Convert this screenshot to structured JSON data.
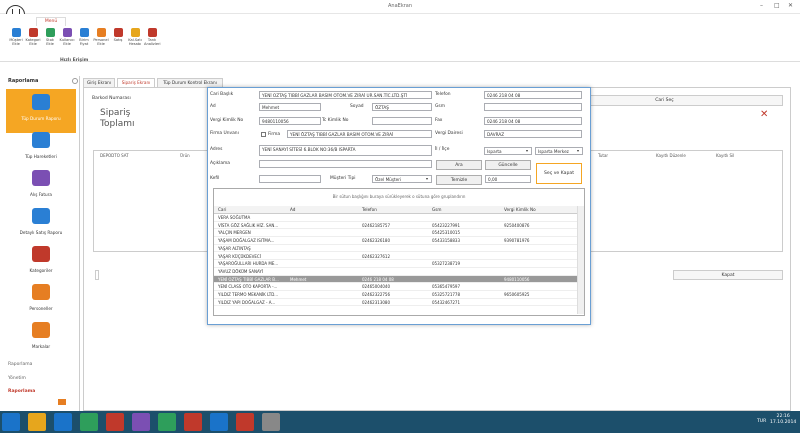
{
  "window": {
    "title": "AnaEkran"
  },
  "ribbon": {
    "tab": "Menü",
    "group": "Hızlı Erişim",
    "buttons": [
      {
        "label": "Müşteri Ekle",
        "color": "#2a7fd4"
      },
      {
        "label": "Kategori Ekle",
        "color": "#c0392b"
      },
      {
        "label": "Stok Ekle",
        "color": "#2e9e5b"
      },
      {
        "label": "Kullanıcı Ekle",
        "color": "#7b4fb3"
      },
      {
        "label": "Birim Fiyat",
        "color": "#2a7fd4"
      },
      {
        "label": "Personel Ekle",
        "color": "#e67e22"
      },
      {
        "label": "Satış",
        "color": "#c0392b"
      },
      {
        "label": "Kal.Satı Hesabı",
        "color": "#e6a61d"
      },
      {
        "label": "Tank Analizleri",
        "color": "#c0392b"
      }
    ]
  },
  "sidebar": {
    "title": "Raporlama",
    "items": [
      {
        "label": "Tüp Durum Raporu",
        "icon": "report-icon",
        "color": "#2a7fd4"
      },
      {
        "label": "Tüp Hareketleri",
        "icon": "tube-icon",
        "color": "#2a7fd4"
      },
      {
        "label": "Alış Fatura",
        "icon": "invoice-icon",
        "color": "#7b4fb3"
      },
      {
        "label": "Detaylı Satış Raporu",
        "icon": "globe-icon",
        "color": "#2a7fd4"
      },
      {
        "label": "Kategoriler",
        "icon": "category-icon",
        "color": "#c0392b"
      },
      {
        "label": "Personeller",
        "icon": "people-icon",
        "color": "#e67e22"
      },
      {
        "label": "Markalar",
        "icon": "brand-icon",
        "color": "#e67e22"
      }
    ],
    "bottom": [
      "Raporlama",
      "Yönetim",
      "Raporlama"
    ]
  },
  "tabs": [
    "Giriş Ekranı",
    "Sipariş Ekranı",
    "Tüp Durum Kontrol Ekranı"
  ],
  "background": {
    "barkod": "Barkod Numarası",
    "title1": "Sipariş",
    "title2": "Toplamı",
    "cari_sec": "Cari Seç",
    "kapat": "Kapat",
    "columns": [
      "DEPODTO SAT",
      "Ürün",
      "Tutar",
      "Kayıtlı Düzenle",
      "Kayıtlı Sil"
    ]
  },
  "dialog": {
    "labels": {
      "cari": "Cari Başlık",
      "ad": "Ad",
      "soyad": "Soyad",
      "vergi_no": "Vergi Kimlik No",
      "tc": "Tc Kimlik No",
      "firma": "Firma Unvanı",
      "firma_chk": "Firma",
      "adres": "Adres",
      "aciklama": "Açıklama",
      "kefil": "Kefil",
      "musteri_tipi": "Müşteri Tipi",
      "telefon": "Telefon",
      "gsm": "Gsm",
      "fax": "Fax",
      "vergi_dairesi": "Vergi Dairesi",
      "il_ilce": "İl / İlçe"
    },
    "values": {
      "cari": "YENİ OZTAŞ TIBBİ GAZLAR BASIM OTOM.VE ZIRAİ UR.SAN.TİC.LTD.ŞTİ",
      "ad": "Mehmet",
      "soyad": "ÖZTAŞ",
      "vergi_no": "9480110056",
      "tc": "",
      "firma": "YENİ ÖZTAŞ TIBBİ GAZLAR BASIM OTOM.VE ZIRAİ",
      "adres": "YENİ SANAYİ SİTESİ 6.BLOK NO:36/B ISPARTA",
      "aciklama": "",
      "kefil": "",
      "musteri_tipi": "Özel Müşteri",
      "telefon": "0246 218 04 08",
      "gsm": "",
      "fax": "0246 218 04 08",
      "vergi_dairesi": "DAVRAZ",
      "il": "Isparta",
      "ilce": "Isparta Merkez",
      "tutar": "0,00"
    },
    "buttons": {
      "ara": "Ara",
      "guncelle": "Güncelle",
      "temizle": "Temizle",
      "sec_kapat": "Seç ve Kapat"
    },
    "grid": {
      "hint": "Bir sütun başlığını buraya sürükleyerek o sütuna göre gruplandırın",
      "columns": [
        "Cari",
        "Ad",
        "Telefon",
        "Gsm",
        "Vergi Kimlik No"
      ],
      "rows": [
        [
          "VERA SOĞUTMA",
          "",
          "",
          "",
          ""
        ],
        [
          "VİSTA GÖZ SAĞLIK HİZ. SAN...",
          "",
          "02462185757",
          "05423227991",
          "9250400876"
        ],
        [
          "YALÇIN MERGEN",
          "",
          "",
          "05425310015",
          ""
        ],
        [
          "YAŞAM DOĞALGAZ ISITMA...",
          "",
          "02462326180",
          "05433158833",
          "9390781976"
        ],
        [
          "YAŞAR ALTINTAŞ",
          "",
          "",
          "",
          ""
        ],
        [
          "YAŞAR KÜÇÜKDEVECİ",
          "",
          "02462327612",
          "",
          ""
        ],
        [
          "YAŞAROĞULLARI HURDA ME...",
          "",
          "",
          "05327238719",
          ""
        ],
        [
          "YAVUZ DÖKÜM SANAYİ",
          "",
          "",
          "",
          ""
        ],
        [
          "YENİ OZTAŞ TIBBİ GAZLAR B...",
          "Mehmet",
          "0246 218 04 08",
          "",
          "9480110056"
        ],
        [
          "YENİ CLASS OTO KAPORTA -...",
          "",
          "02465004040",
          "05365479597",
          ""
        ],
        [
          "YILDIZ TERMO MEKANİK LTD...",
          "",
          "02462322756",
          "05325721778",
          "9650605925"
        ],
        [
          "YILDIZ YAPI DOĞALGAZ - A...",
          "",
          "02462313080",
          "05432467271",
          ""
        ]
      ],
      "selected": 8
    }
  },
  "taskbar": {
    "time": "22:16",
    "date": "17.10.2014",
    "lang": "TUR"
  }
}
